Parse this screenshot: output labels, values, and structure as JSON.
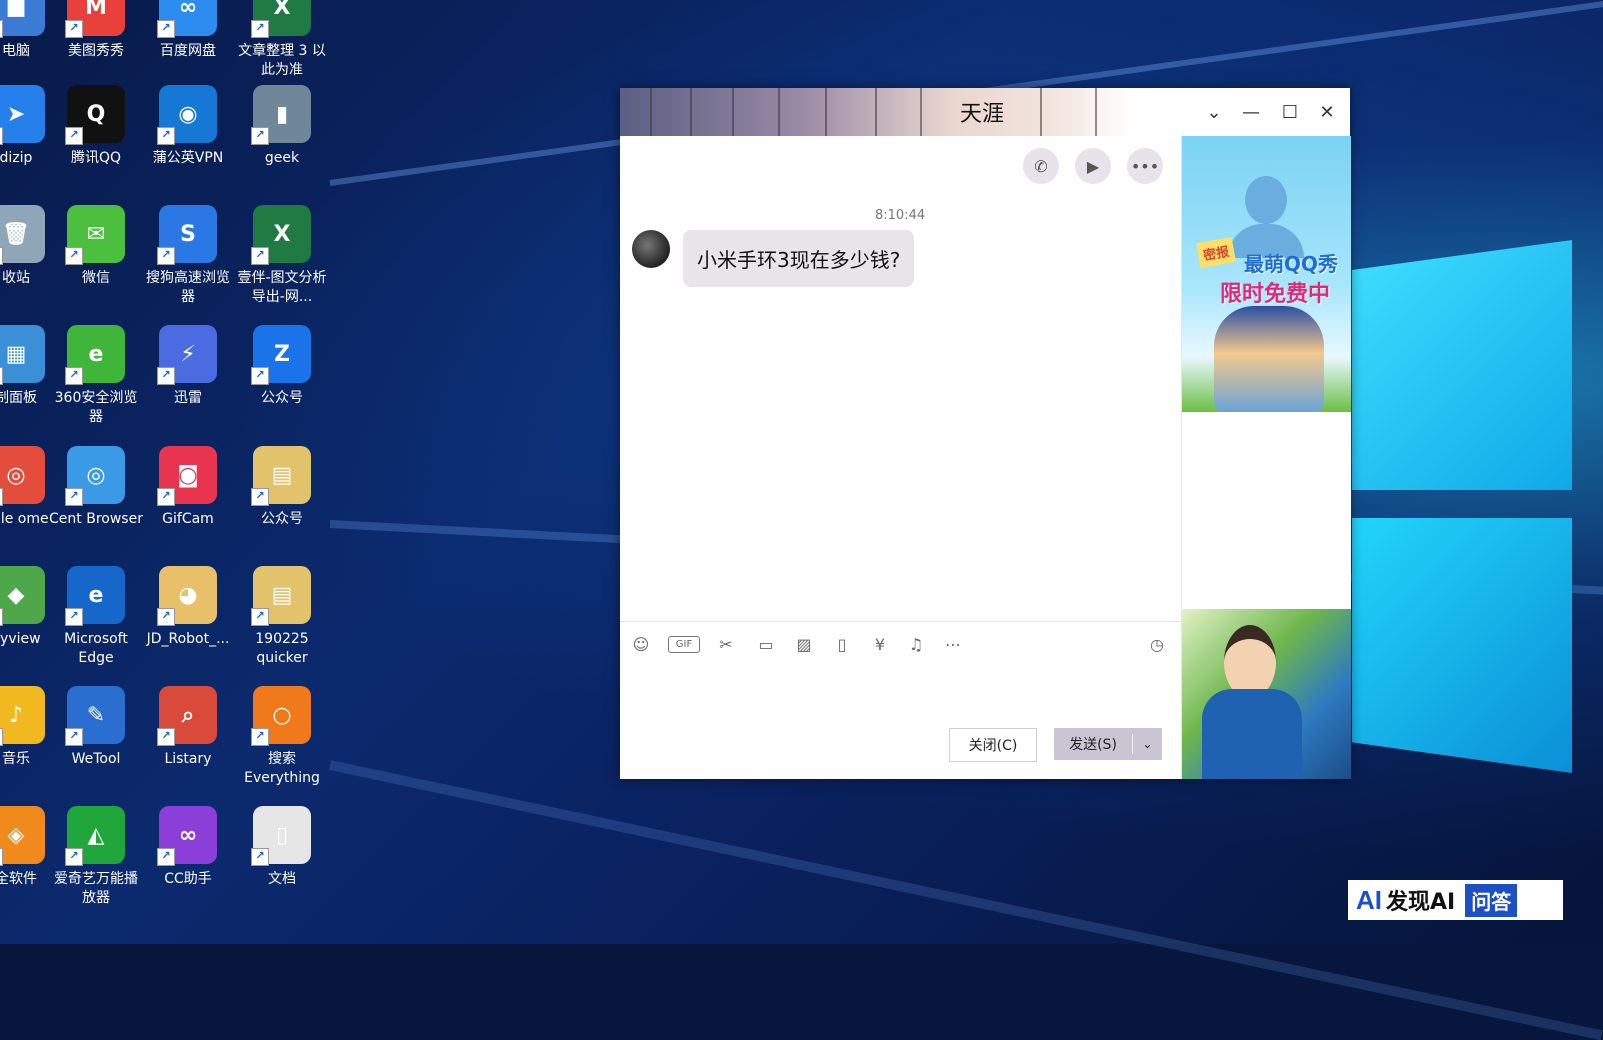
{
  "desktop": {
    "icons": [
      {
        "label": "电脑",
        "glyph": "■",
        "color": "#3c7bd5"
      },
      {
        "label": "美图秀秀",
        "glyph": "M",
        "color": "#e8413b"
      },
      {
        "label": "百度网盘",
        "glyph": "∞",
        "color": "#2d8cf0"
      },
      {
        "label": "文章整理 3 以此为准",
        "glyph": "X",
        "color": "#1f7a44"
      },
      {
        "label": "dizip",
        "glyph": "➤",
        "color": "#2680eb"
      },
      {
        "label": "腾讯QQ",
        "glyph": "Q",
        "color": "#111111"
      },
      {
        "label": "蒲公英VPN",
        "glyph": "◉",
        "color": "#1478d4"
      },
      {
        "label": "geek",
        "glyph": "▮",
        "color": "#6f8798"
      },
      {
        "label": "收站",
        "glyph": "🗑",
        "color": "#8fa6b8"
      },
      {
        "label": "微信",
        "glyph": "✉",
        "color": "#4cbf3e"
      },
      {
        "label": "搜狗高速浏览器",
        "glyph": "S",
        "color": "#2b78e4"
      },
      {
        "label": "壹伴-图文分析导出-网...",
        "glyph": "X",
        "color": "#1f7a44"
      },
      {
        "label": "制面板",
        "glyph": "▦",
        "color": "#3a8fd6"
      },
      {
        "label": "360安全浏览器",
        "glyph": "e",
        "color": "#3fb53a"
      },
      {
        "label": "迅雷",
        "glyph": "⚡",
        "color": "#4b6be0"
      },
      {
        "label": "公众号",
        "glyph": "Z",
        "color": "#1a73e8"
      },
      {
        "label": "ogle ome",
        "glyph": "◎",
        "color": "#e44c3c"
      },
      {
        "label": "Cent Browser",
        "glyph": "◎",
        "color": "#3b9ae6"
      },
      {
        "label": "GifCam",
        "glyph": "◙",
        "color": "#e8344e"
      },
      {
        "label": "公众号",
        "glyph": "▤",
        "color": "#e2c26b"
      },
      {
        "label": "eyview",
        "glyph": "◆",
        "color": "#4ea84a"
      },
      {
        "label": "Microsoft Edge",
        "glyph": "e",
        "color": "#1568c9"
      },
      {
        "label": "JD_Robot_...",
        "glyph": "◕",
        "color": "#e9c06a"
      },
      {
        "label": "190225 quicker",
        "glyph": "▤",
        "color": "#e2c26b"
      },
      {
        "label": "音乐",
        "glyph": "♪",
        "color": "#f1b81f"
      },
      {
        "label": "WeTool",
        "glyph": "✎",
        "color": "#2a6ed0"
      },
      {
        "label": "Listary",
        "glyph": "⌕",
        "color": "#d94a3a"
      },
      {
        "label": "搜索 Everything",
        "glyph": "○",
        "color": "#f07a1b"
      },
      {
        "label": "全软件",
        "glyph": "◈",
        "color": "#f08a1c"
      },
      {
        "label": "爱奇艺万能播放器",
        "glyph": "◭",
        "color": "#1fa73b"
      },
      {
        "label": "CC助手",
        "glyph": "∞",
        "color": "#8b3fd8"
      },
      {
        "label": "文档",
        "glyph": "▯",
        "color": "#e6e6e6"
      }
    ],
    "shortcut_mark": "↗"
  },
  "chat": {
    "title": "天涯",
    "window_controls": {
      "dropdown": "⌄",
      "minimize": "—",
      "maximize": "☐",
      "close": "✕"
    },
    "header_actions": {
      "voice_call": "✆",
      "video_call": "▶",
      "more": "•••"
    },
    "timestamp": "8:10:44",
    "message": "小米手环3现在多少钱?",
    "toolbar": {
      "emoji": "☺",
      "gif": "GIF",
      "screenshot": "✂",
      "file": "▭",
      "image": "▨",
      "shake": "▯",
      "red_packet": "¥",
      "music": "♫",
      "more": "⋯",
      "history": "◷"
    },
    "buttons": {
      "close": "关闭(C)",
      "send": "发送(S)",
      "send_menu": "⌄"
    }
  },
  "sidebar_ad": {
    "tag": "密报",
    "promo_line1": "最萌QQ秀",
    "promo_line2": "限时免费中"
  },
  "watermark": {
    "logo": "AI",
    "brand": "发现AI",
    "badge": "问答"
  }
}
